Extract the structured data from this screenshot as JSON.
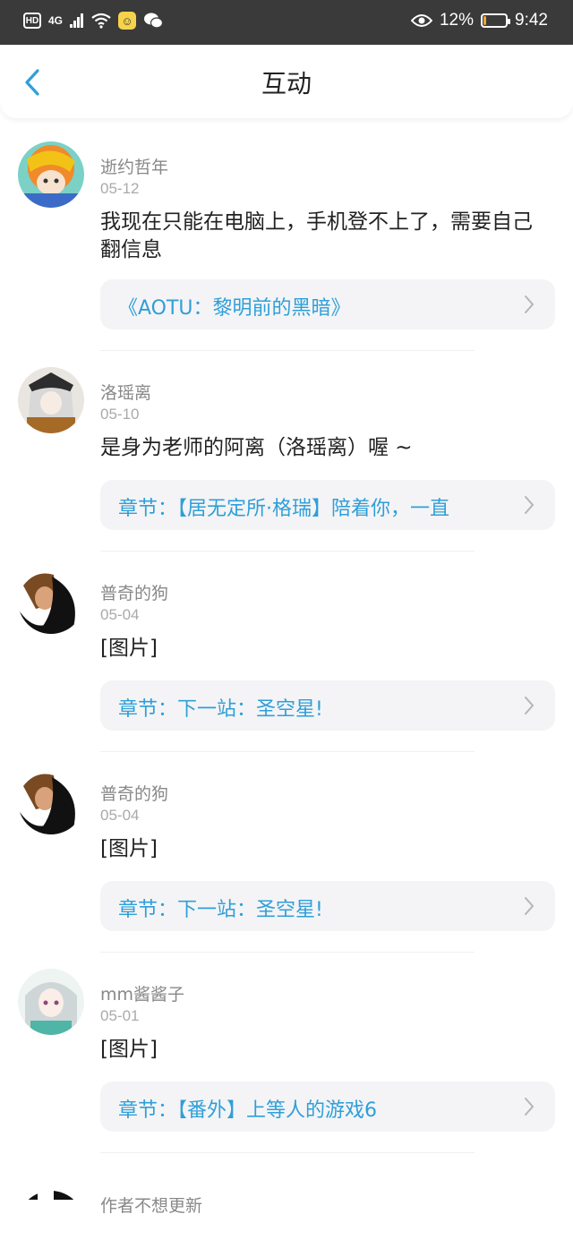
{
  "status_bar": {
    "network": "4G",
    "battery": "12%",
    "time": "9:42",
    "battery_level": 0.12
  },
  "header": {
    "title": "互动",
    "back_icon": "chevron-left-icon"
  },
  "items": [
    {
      "name": "逝约哲年",
      "date": "05-12",
      "content": "我现在只能在电脑上，手机登不上了，需要自己翻信息",
      "card": "《AOTU：黎明前的黑暗》"
    },
    {
      "name": "洛瑶离",
      "date": "05-10",
      "content": "是身为老师的阿离（洛瑶离）喔 ~",
      "card": "章节：【居无定所·格瑞】陪着你，一直"
    },
    {
      "name": "普奇的狗",
      "date": "05-04",
      "content": "[图片]",
      "card": "章节：下一站：圣空星!"
    },
    {
      "name": "普奇的狗",
      "date": "05-04",
      "content": "[图片]",
      "card": "章节：下一站：圣空星!"
    },
    {
      "name": "mm酱酱子",
      "date": "05-01",
      "content": "[图片]",
      "card": "章节：【番外】上等人的游戏6"
    }
  ],
  "partial_item": {
    "name": "作者不想更新"
  },
  "colors": {
    "accent": "#2f9fd8",
    "status_bar": "#3a3a3a"
  }
}
